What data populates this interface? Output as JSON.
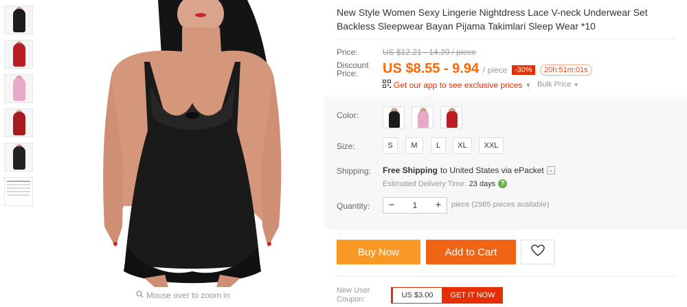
{
  "product": {
    "title": "New Style Women Sexy Lingerie Nightdress Lace V-neck Underwear Set Backless Sleepwear Bayan Pijama Takimlari Sleep Wear *10"
  },
  "gallery": {
    "zoom_hint": "Mouse over to zoom in",
    "thumbnails": [
      "black",
      "red",
      "pink",
      "red",
      "black",
      "size-chart"
    ]
  },
  "price": {
    "label": "Price:",
    "original": "US $12.21 - 14.20 / piece",
    "discount_label": "Discount Price:",
    "discount": "US $8.55 - 9.94",
    "unit": "/ piece",
    "percent_off": "-30%",
    "countdown": "20h:51m:01s",
    "app_link": "Get our app to see exclusive prices",
    "bulk": "Bulk Price"
  },
  "options": {
    "color_label": "Color:",
    "colors": [
      "black",
      "pink",
      "red"
    ],
    "size_label": "Size:",
    "sizes": [
      "S",
      "M",
      "L",
      "XL",
      "XXL"
    ]
  },
  "shipping": {
    "label": "Shipping:",
    "text_prefix": "Free Shipping",
    "text_suffix": "to United States via ePacket",
    "delivery_label": "Estimated Delivery Time:",
    "delivery_days": "23 days"
  },
  "quantity": {
    "label": "Quantity:",
    "value": "1",
    "available": "piece (2985 pieces available)"
  },
  "actions": {
    "buy_now": "Buy Now",
    "add_to_cart": "Add to Cart"
  },
  "coupon": {
    "label": "New User Coupon:",
    "amount": "US $3.00",
    "get": "GET IT NOW"
  },
  "colors": {
    "price": "#ff6600",
    "buy_now": "#f99825",
    "add_to_cart": "#f06416",
    "badge": "#e62e04",
    "black_product": "#1c1c1c",
    "red_product": "#b81e24",
    "pink_product": "#e8a9c8"
  }
}
